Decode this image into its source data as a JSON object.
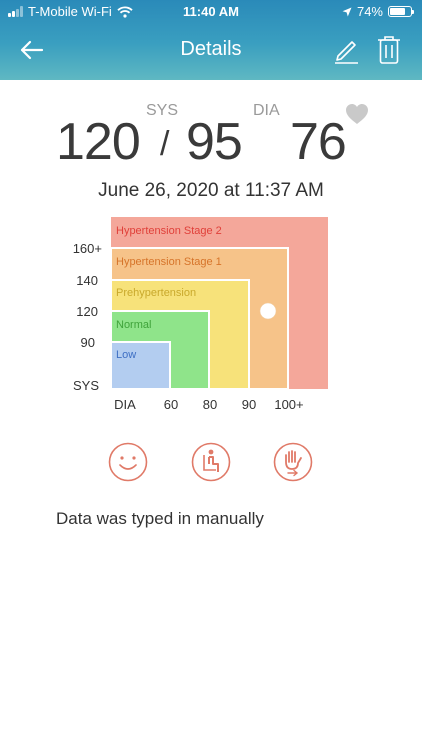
{
  "status_bar": {
    "carrier": "T-Mobile Wi-Fi",
    "time": "11:40 AM",
    "battery": "74%",
    "battery_level": 0.74
  },
  "nav": {
    "title": "Details"
  },
  "reading": {
    "sys": "120",
    "sys_label": "SYS",
    "slash": "/",
    "dia": "95",
    "dia_label": "DIA",
    "pulse": "76"
  },
  "date": "June 26, 2020 at 11:37 AM",
  "chart_data": {
    "type": "heatmap",
    "zones": [
      {
        "name": "Hypertension Stage 2",
        "color": "#f4a79a",
        "text_color": "#e0403a"
      },
      {
        "name": "Hypertension Stage 1",
        "color": "#f6c389",
        "text_color": "#d6742a"
      },
      {
        "name": "Prehypertension",
        "color": "#f7e27a",
        "text_color": "#c9a92c"
      },
      {
        "name": "Normal",
        "color": "#8fe48a",
        "text_color": "#3fa33a"
      },
      {
        "name": "Low",
        "color": "#b3cdf0",
        "text_color": "#3e6fc4"
      }
    ],
    "y_ticks": [
      "160+",
      "140",
      "120",
      "90",
      "SYS"
    ],
    "x_ticks": [
      "DIA",
      "60",
      "80",
      "90",
      "100+"
    ],
    "point": {
      "sys": 120,
      "dia": 95
    }
  },
  "icons": [
    {
      "name": "smiley-face-icon"
    },
    {
      "name": "seated-person-icon"
    },
    {
      "name": "hand-arrow-icon"
    }
  ],
  "colors": {
    "accent": "#e07a68",
    "header_top": "#2a8ab9",
    "header_bottom": "#5fb8c2"
  },
  "note": "Data was typed in manually"
}
